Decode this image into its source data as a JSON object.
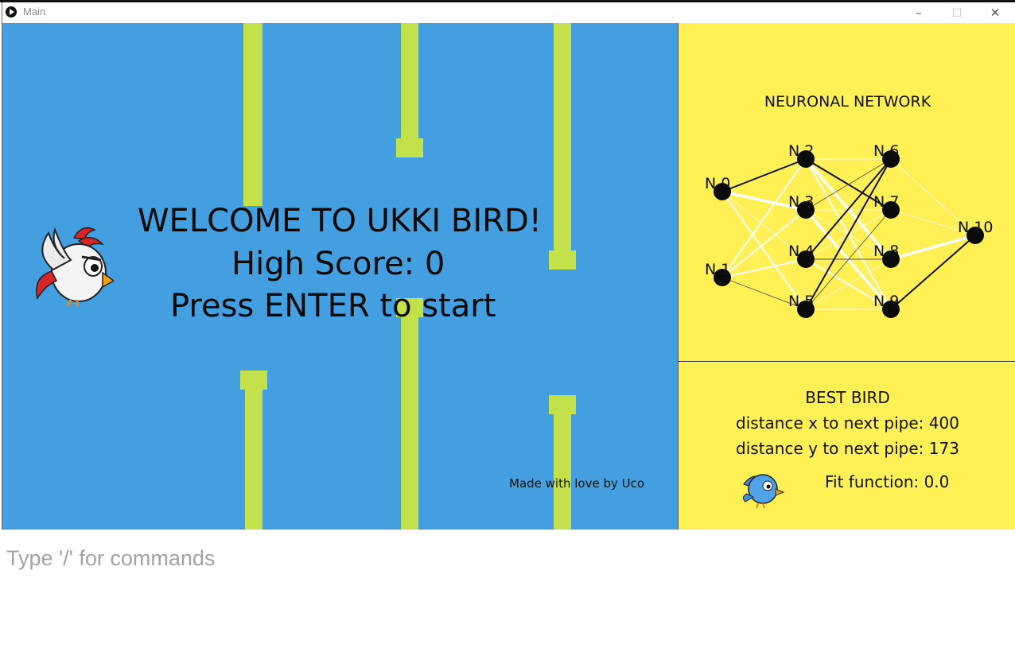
{
  "window": {
    "title": "Main",
    "minimize_glyph": "–",
    "maximize_glyph": "□",
    "close_glyph": "✕"
  },
  "game": {
    "welcome_line": "WELCOME TO UKKI BIRD!",
    "high_score_line": "High Score: 0",
    "start_line": "Press ENTER to start",
    "credit": "Made with love by Uco",
    "colors": {
      "sky": "#449fe0",
      "pipe": "#c3e14a"
    }
  },
  "network_panel": {
    "title": "NEURONAL NETWORK",
    "nodes": [
      "N 0",
      "N 1",
      "N 2",
      "N 3",
      "N 4",
      "N 5",
      "N 6",
      "N 7",
      "N 8",
      "N 9",
      "N 10"
    ]
  },
  "best_bird": {
    "title": "BEST BIRD",
    "distance_x": "distance x to next pipe: 400",
    "distance_y": "distance y to next pipe: 173",
    "fit": "Fit function: 0.0"
  },
  "command_bar": {
    "placeholder": "Type '/' for commands"
  },
  "colors": {
    "panel": "#fff055"
  }
}
